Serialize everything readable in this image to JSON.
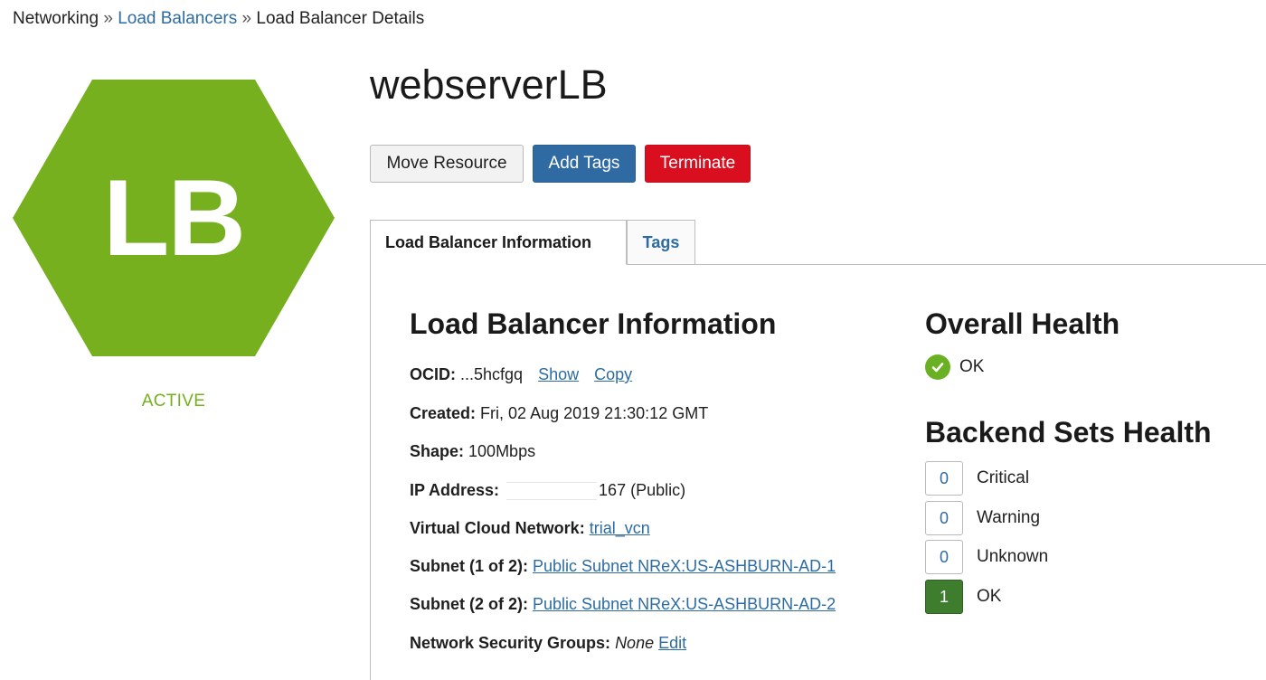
{
  "breadcrumb": {
    "root": "Networking",
    "separator": "»",
    "parent": "Load Balancers",
    "current": "Load Balancer Details"
  },
  "resource": {
    "badge_text": "LB",
    "badge_color": "#76b01e",
    "state": "ACTIVE",
    "title": "webserverLB"
  },
  "actions": {
    "move": "Move Resource",
    "add_tags": "Add Tags",
    "terminate": "Terminate"
  },
  "tabs": [
    {
      "label": "Load Balancer Information",
      "active": true
    },
    {
      "label": "Tags",
      "active": false
    }
  ],
  "info": {
    "heading": "Load Balancer Information",
    "ocid_label": "OCID:",
    "ocid_value": "...5hcfgq",
    "ocid_show": "Show",
    "ocid_copy": "Copy",
    "created_label": "Created:",
    "created_value": "Fri, 02 Aug 2019 21:30:12 GMT",
    "shape_label": "Shape:",
    "shape_value": "100Mbps",
    "ip_label": "IP Address:",
    "ip_value": "167 (Public)",
    "vcn_label": "Virtual Cloud Network:",
    "vcn_value": "trial_vcn",
    "subnet1_label": "Subnet (1 of 2):",
    "subnet1_value": "Public Subnet NReX:US-ASHBURN-AD-1",
    "subnet2_label": "Subnet (2 of 2):",
    "subnet2_value": "Public Subnet NReX:US-ASHBURN-AD-2",
    "nsg_label": "Network Security Groups:",
    "nsg_value": "None",
    "nsg_edit": "Edit"
  },
  "health": {
    "heading": "Overall Health",
    "status": "OK",
    "status_icon": "check-circle-icon",
    "status_color": "#6ab023"
  },
  "backend_health": {
    "heading": "Backend Sets Health",
    "items": [
      {
        "count": "0",
        "label": "Critical"
      },
      {
        "count": "0",
        "label": "Warning"
      },
      {
        "count": "0",
        "label": "Unknown"
      },
      {
        "count": "1",
        "label": "OK"
      }
    ]
  }
}
